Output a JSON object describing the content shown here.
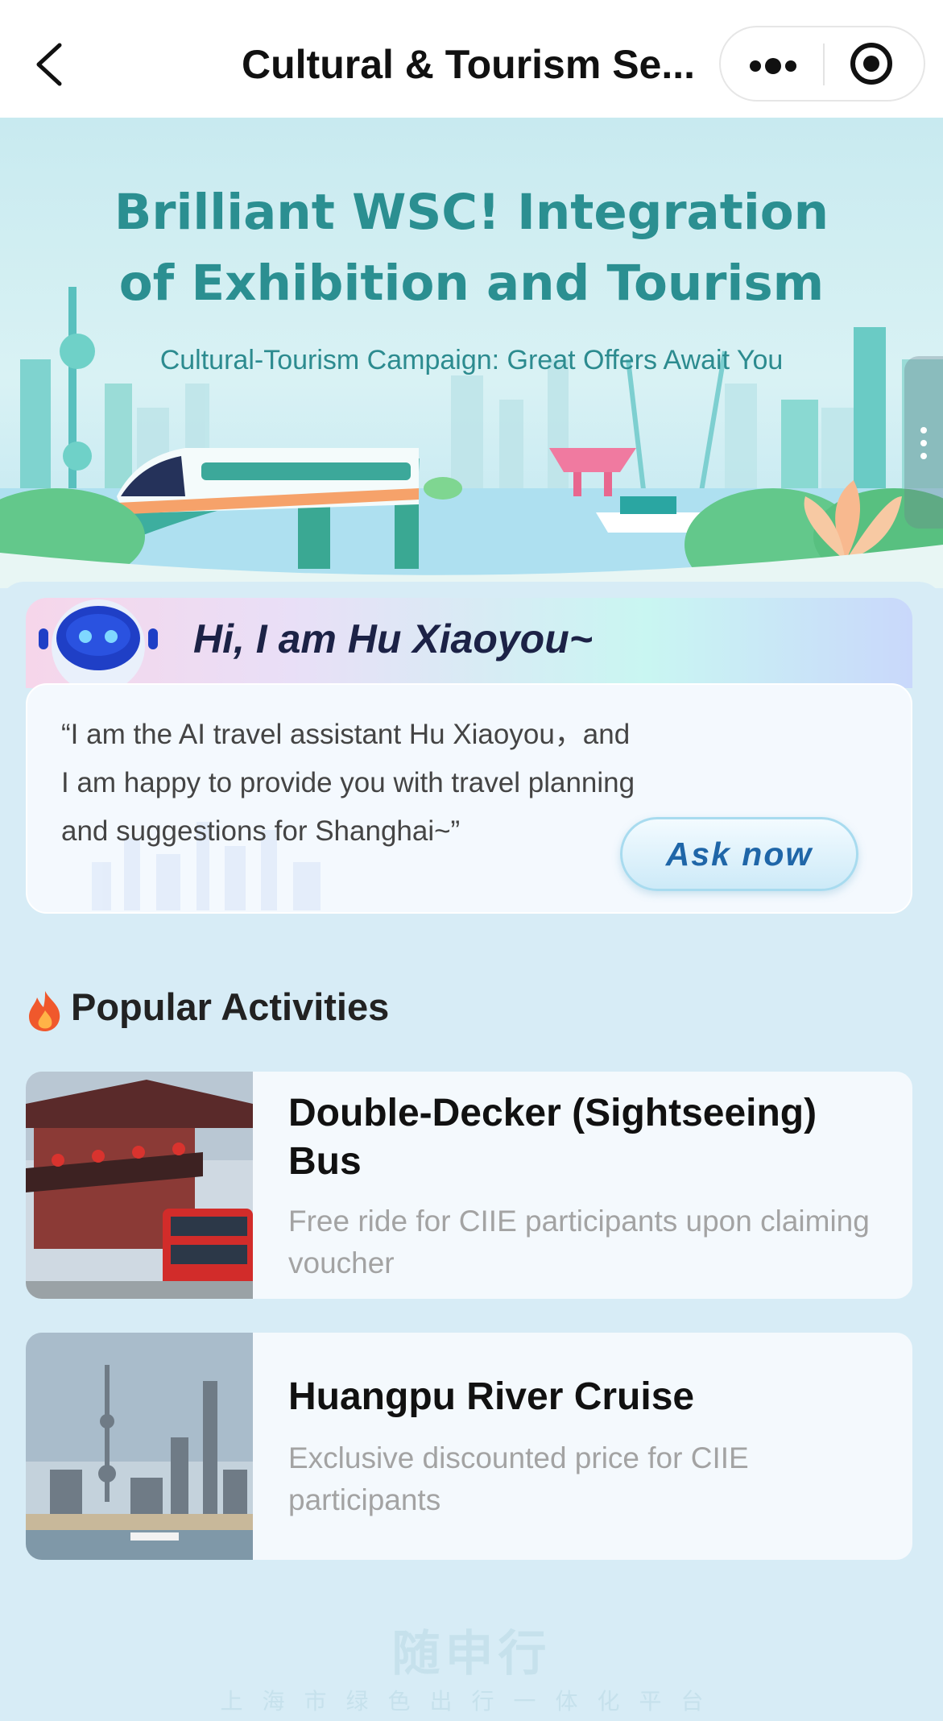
{
  "nav": {
    "title": "Cultural & Tourism Se..."
  },
  "hero": {
    "title_line1": "Brilliant WSC! Integration",
    "title_line2": "of Exhibition and Tourism",
    "subtitle": "Cultural-Tourism Campaign: Great Offers Await You"
  },
  "assistant": {
    "greeting": "Hi,  I am Hu Xiaoyou~",
    "message": "“I am the AI travel assistant Hu Xiaoyou，and I am happy to provide you with travel planning and suggestions for Shanghai~”",
    "ask_label": "Ask now"
  },
  "popular": {
    "title": "Popular Activities",
    "items": [
      {
        "title": "Double-Decker (Sightseeing) Bus",
        "desc": "Free ride for CIIE participants upon claiming voucher"
      },
      {
        "title": "Huangpu River Cruise",
        "desc": "Exclusive discounted price for CIIE participants"
      }
    ]
  },
  "footer": {
    "logo": "随申行",
    "tagline": "上海市绿色出行一体化平台"
  },
  "colors": {
    "accent": "#2b8f91",
    "page_bg": "#d7ecf6",
    "button_text": "#1f66a8"
  }
}
